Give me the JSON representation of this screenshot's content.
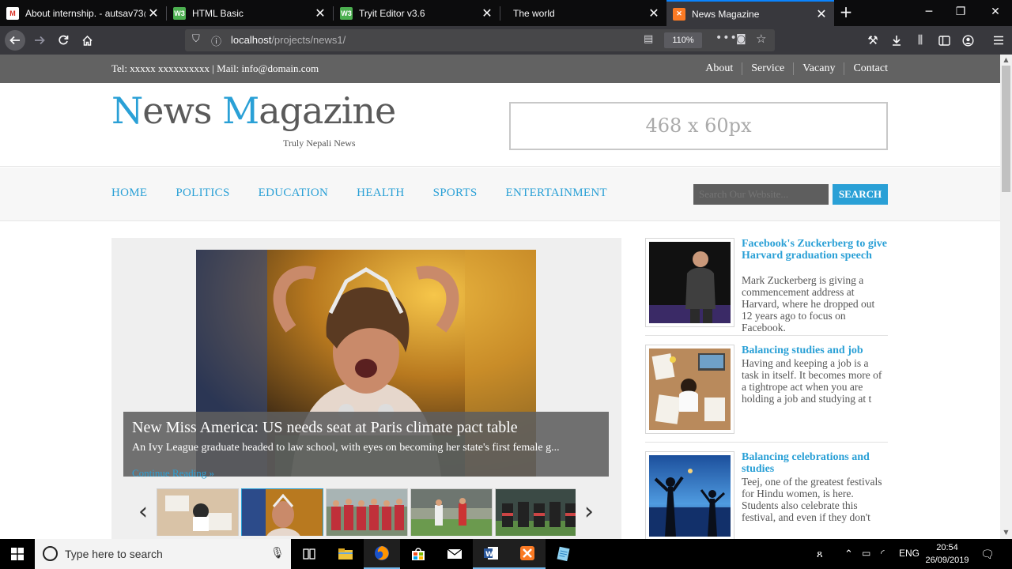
{
  "browser": {
    "tabs": [
      {
        "title": "About internship. - autsav73@",
        "icon": "gmail-icon",
        "color": "#d93025"
      },
      {
        "title": "HTML Basic",
        "icon": "editor-icon",
        "color": "#4caf50"
      },
      {
        "title": "Tryit Editor v3.6",
        "icon": "editor-icon",
        "color": "#4caf50"
      },
      {
        "title": "The world",
        "icon": "",
        "color": ""
      },
      {
        "title": "News Magazine",
        "icon": "xampp-icon",
        "color": "#fb7a24"
      }
    ],
    "url_host": "localhost",
    "url_path": "/projects/news1/",
    "zoom": "110%"
  },
  "site": {
    "topbar": {
      "contact": "Tel: xxxxx xxxxxxxxxx | Mail: info@domain.com",
      "links": [
        "About",
        "Service",
        "Vacany",
        "Contact"
      ]
    },
    "logo": {
      "n": "N",
      "ews": "ews ",
      "m": "M",
      "agazine": "agazine"
    },
    "tagline": "Truly Nepali News",
    "ad_text": "468 x 60px",
    "nav": [
      "HOME",
      "POLITICS",
      "EDUCATION",
      "HEALTH",
      "SPORTS",
      "ENTERTAINMENT"
    ],
    "search_placeholder": "Search Our Website...",
    "search_button": "SEARCH",
    "slider": {
      "title": "New Miss America: US needs seat at Paris climate pact table",
      "excerpt": "An Ivy League graduate headed to law school, with eyes on becoming her state's first female g...",
      "more": "Continue Reading »",
      "prev": "‹",
      "next": "›"
    },
    "news": [
      {
        "title": "Facebook's Zuckerberg to give Harvard graduation speech",
        "text": "Mark Zuckerberg is giving a commencement address at Harvard, where he dropped out 12 years ago to focus on Facebook."
      },
      {
        "title": "Balancing studies and job",
        "text": "Having and keeping a job is a task in itself. It becomes more of a tightrope act when you are holding a job and studying at t"
      },
      {
        "title": "Balancing celebrations and studies",
        "text": "Teej, one of the greatest festivals for Hindu women, is here. Students also celebrate this festival, and even if they don't"
      }
    ]
  },
  "taskbar": {
    "search_placeholder": "Type here to search",
    "language": "ENG",
    "time": "20:54",
    "date": "26/09/2019"
  },
  "colors": {
    "accent": "#2aa0d6",
    "topbar": "#626262",
    "browser_dark": "#0c0c0d"
  }
}
